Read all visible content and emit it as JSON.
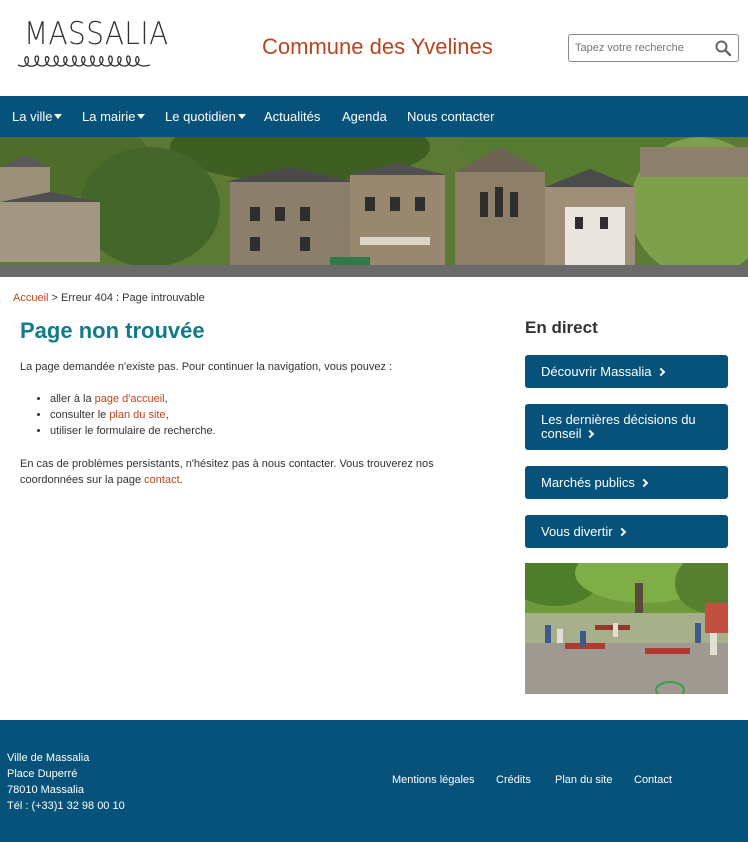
{
  "header": {
    "logo_text": "MASSALIA",
    "site_title": "Commune des Yvelines",
    "search": {
      "placeholder": "Tapez votre recherche"
    }
  },
  "nav": {
    "items": [
      {
        "label": "La ville",
        "dropdown": true
      },
      {
        "label": "La mairie",
        "dropdown": true
      },
      {
        "label": "Le quotidien",
        "dropdown": true
      },
      {
        "label": "Actualités",
        "dropdown": false
      },
      {
        "label": "Agenda",
        "dropdown": false
      },
      {
        "label": "Nous contacter",
        "dropdown": false
      }
    ]
  },
  "breadcrumb": {
    "home": "Accueil",
    "separator": ">",
    "current": "Erreur 404 : Page introuvable"
  },
  "main": {
    "title": "Page non trouvée",
    "intro": "La page demandée n'existe pas. Pour continuer la navigation, vous pouvez :",
    "options": [
      {
        "before": "aller à la ",
        "link": "page d'accueil",
        "after": ","
      },
      {
        "before": "consulter le ",
        "link": "plan du site",
        "after": ","
      },
      {
        "before": "utiliser le formulaire de recherche.",
        "link": "",
        "after": ""
      }
    ],
    "outro_before": "En cas de problèmes persistants, n'hésitez pas à nous contacter. Vous trouverez nos coordonnées sur la page ",
    "outro_link": "contact",
    "outro_after": "."
  },
  "aside": {
    "title": "En direct",
    "buttons": [
      {
        "label": "Découvrir Massalia"
      },
      {
        "label": "Les dernières décisions du conseil"
      },
      {
        "label": "Marchés publics"
      },
      {
        "label": "Vous divertir"
      }
    ]
  },
  "footer": {
    "address": [
      "Ville de Massalia",
      "Place Duperré",
      "78010 Massalia",
      "Tél : (+33)1 32 98 00 10"
    ],
    "links": [
      "Mentions légales",
      "Crédits",
      "Plan du site",
      "Contact"
    ]
  },
  "colors": {
    "primary_blue": "#06527a",
    "accent_orange": "#b9451f",
    "title_teal": "#127a8a"
  },
  "icons": [
    "search-icon",
    "caret-down-icon",
    "chevron-right-icon"
  ]
}
